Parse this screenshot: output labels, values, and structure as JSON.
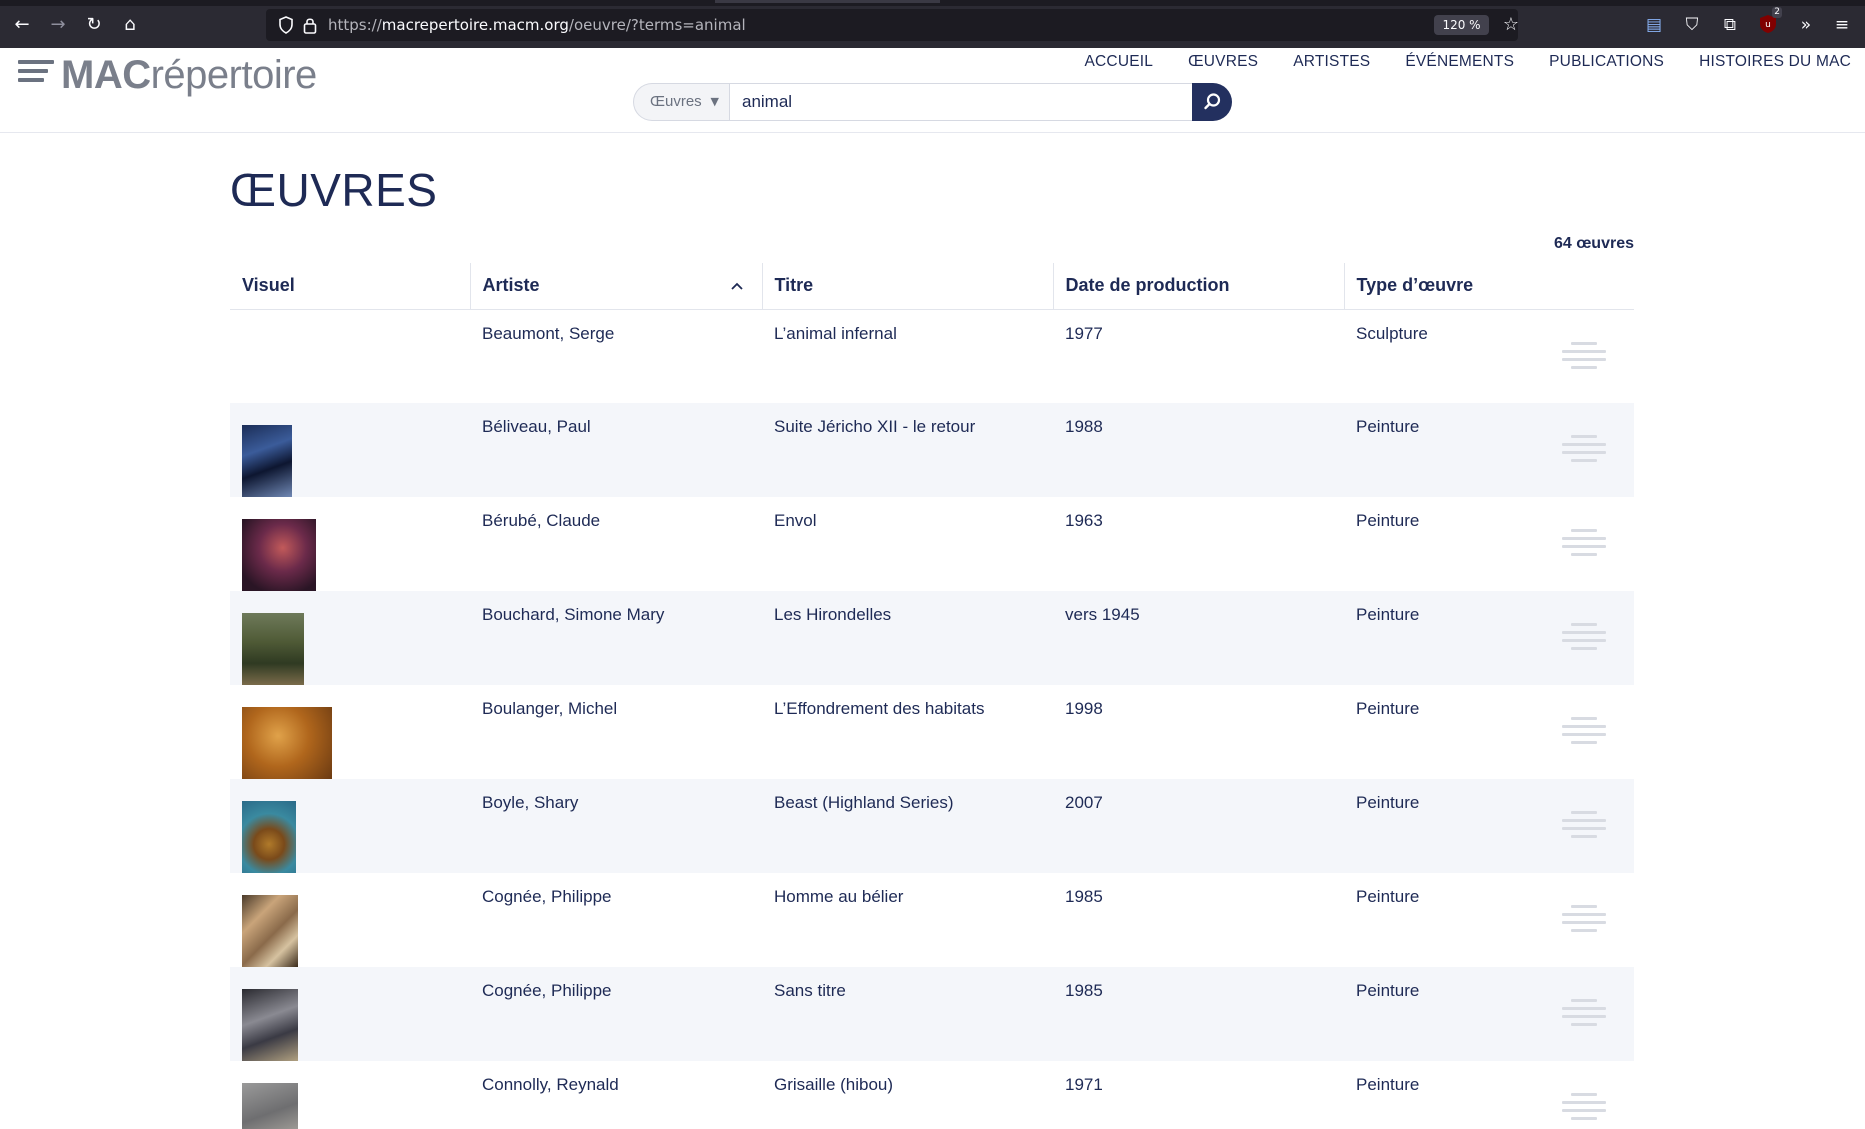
{
  "browser": {
    "url_prefix": "https://",
    "url_host": "macrepertoire.macm.org",
    "url_path": "/oeuvre/?terms=animal",
    "zoom": "120 %",
    "extension_badge": "2"
  },
  "site": {
    "logo_bold": "MAC",
    "logo_light": "répertoire",
    "nav": [
      "ACCUEIL",
      "ŒUVRES",
      "ARTISTES",
      "ÉVÉNEMENTS",
      "PUBLICATIONS",
      "HISTOIRES DU MAC"
    ]
  },
  "search": {
    "category": "Œuvres",
    "query": "animal"
  },
  "page": {
    "title": "ŒUVRES",
    "count": "64 œuvres"
  },
  "table": {
    "headers": {
      "visual": "Visuel",
      "artist": "Artiste",
      "title": "Titre",
      "date": "Date de production",
      "type": "Type d’œuvre"
    },
    "rows": [
      {
        "artist": "Beaumont, Serge",
        "title": "L’animal infernal",
        "date": "1977",
        "type": "Sculpture",
        "thumb": "none"
      },
      {
        "artist": "Béliveau, Paul",
        "title": "Suite Jéricho XII - le retour",
        "date": "1988",
        "type": "Peinture",
        "thumb": "dark-blue"
      },
      {
        "artist": "Bérubé, Claude",
        "title": "Envol",
        "date": "1963",
        "type": "Peinture",
        "thumb": "red-purple"
      },
      {
        "artist": "Bouchard, Simone Mary",
        "title": "Les Hirondelles",
        "date": "vers 1945",
        "type": "Peinture",
        "thumb": "green-brown"
      },
      {
        "artist": "Boulanger, Michel",
        "title": "L’Effondrement des habitats",
        "date": "1998",
        "type": "Peinture",
        "thumb": "ochre"
      },
      {
        "artist": "Boyle, Shary",
        "title": "Beast (Highland Series)",
        "date": "2007",
        "type": "Peinture",
        "thumb": "teal-amber"
      },
      {
        "artist": "Cognée, Philippe",
        "title": "Homme au bélier",
        "date": "1985",
        "type": "Peinture",
        "thumb": "sepia"
      },
      {
        "artist": "Cognée, Philippe",
        "title": "Sans titre",
        "date": "1985",
        "type": "Peinture",
        "thumb": "dark-grey"
      },
      {
        "artist": "Connolly, Reynald",
        "title": "Grisaille (hibou)",
        "date": "1971",
        "type": "Peinture",
        "thumb": "grey"
      }
    ]
  }
}
